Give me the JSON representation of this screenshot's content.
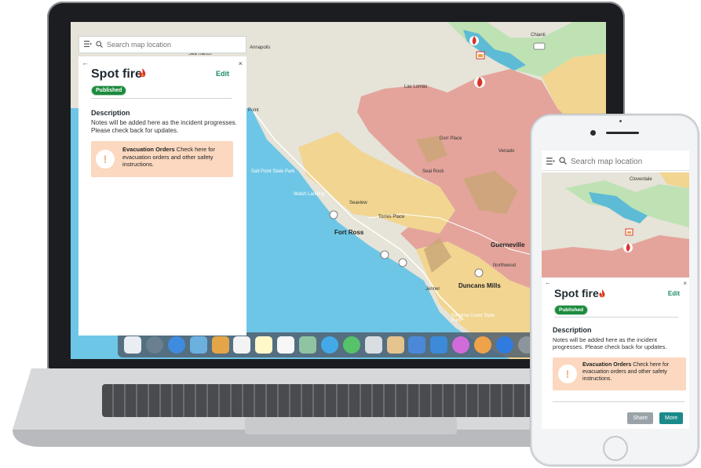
{
  "laptop": {
    "search": {
      "placeholder": "Search map location"
    },
    "panel": {
      "back_glyph": "←",
      "close_glyph": "×",
      "title": "Spot fire",
      "edit_label": "Edit",
      "status_badge": "Published",
      "description_heading": "Description",
      "description_text": "Notes will be added here as the incident progresses. Please check back for updates.",
      "evac_title": "Evacuation Orders",
      "evac_text": " Check here for evacuation orders and other safety instructions.",
      "evac_glyph": "!"
    },
    "map_labels": {
      "sea_ranch": "Sea Ranch",
      "annapolis": "Annapolis",
      "las_lomas": "Las Lomas",
      "cloverdale_hwy": "Chianti",
      "dorr_place": "Dorr Place",
      "venado": "Venado",
      "salt_point": "Salt Point State Park",
      "seaview": "Seaview",
      "walsh_landing": "Walsh Landing",
      "fort_ross": "Fort Ross",
      "guerneville": "Guerneville",
      "northwood": "Northwood",
      "duncans_mills": "Duncans Mills",
      "jenner": "Jenner",
      "sonoma_coast": "Sonoma Coast State Park",
      "torres_place": "Torres Place",
      "cazadero": "Seal Rock",
      "hwy1": "1",
      "hwy101": "101",
      "point": "Point"
    }
  },
  "phone": {
    "search": {
      "placeholder": "Search map location"
    },
    "map_label_cloverdale": "Cloverdale",
    "panel": {
      "back_glyph": "←",
      "close_glyph": "×",
      "title": "Spot fire",
      "edit_label": "Edit",
      "status_badge": "Published",
      "description_heading": "Description",
      "description_text": "Notes will be added here as the incident progresses. Please check back for updates.",
      "evac_title": "Evacuation Orders",
      "evac_text": " Check here for evacuation orders and other safety instructions.",
      "evac_glyph": "!",
      "share_label": "Share",
      "more_label": "More"
    }
  },
  "colors": {
    "accent": "#1b8a6b",
    "published": "#1c8b3e",
    "evac_bg": "#fbd8bf",
    "zone_red": "#e4a49b",
    "zone_yellow": "#f1d590",
    "ocean": "#6ec6e6",
    "dock": "#505f6e"
  },
  "icons": [
    "menu-icon",
    "search-icon",
    "flame-icon",
    "warning-icon",
    "incident-marker-icon"
  ]
}
